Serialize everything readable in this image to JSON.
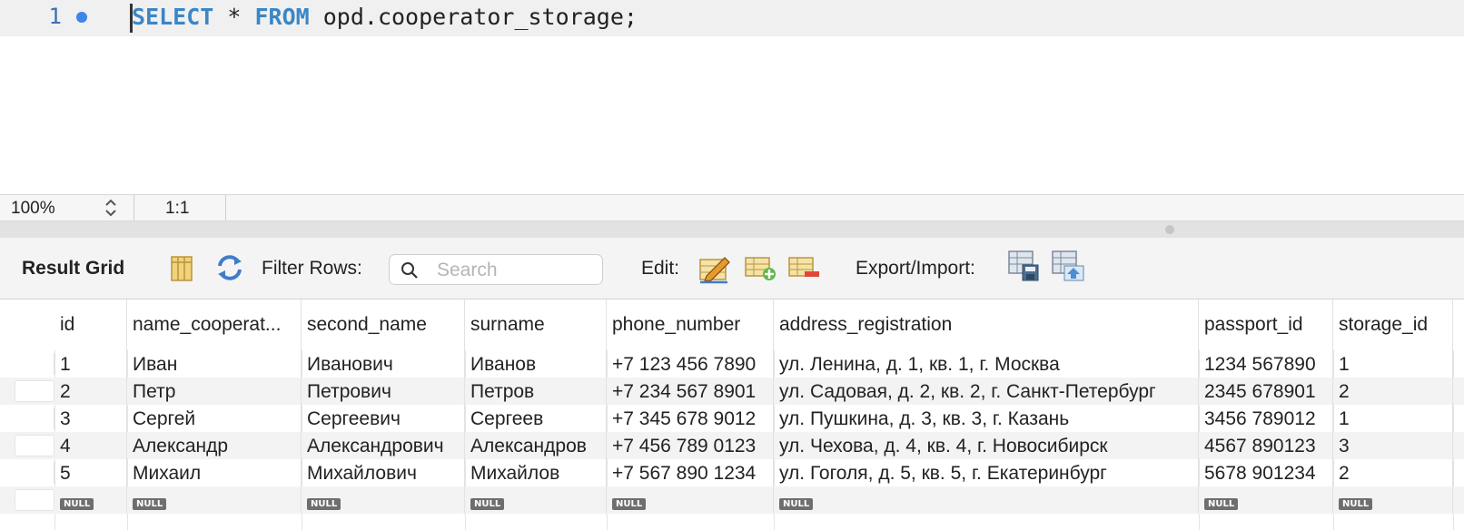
{
  "editor": {
    "line_number": "1",
    "sql_keyword_select": "SELECT",
    "sql_star": " * ",
    "sql_keyword_from": "FROM",
    "sql_rest": " opd.cooperator_storage;"
  },
  "status": {
    "zoom": "100%",
    "position": "1:1"
  },
  "toolbar": {
    "title": "Result Grid",
    "filter_label": "Filter Rows:",
    "search_placeholder": "Search",
    "search_value": "",
    "edit_label": "Edit:",
    "export_label": "Export/Import:"
  },
  "grid": {
    "columns": [
      "id",
      "name_cooperat...",
      "second_name",
      "surname",
      "phone_number",
      "address_registration",
      "passport_id",
      "storage_id"
    ],
    "rows": [
      [
        "1",
        "Иван",
        "Иванович",
        "Иванов",
        "+7 123 456 7890",
        "ул. Ленина, д. 1, кв. 1, г. Москва",
        "1234 567890",
        "1"
      ],
      [
        "2",
        "Петр",
        "Петрович",
        "Петров",
        "+7 234 567 8901",
        "ул. Садовая, д. 2, кв. 2, г. Санкт-Петербург",
        "2345 678901",
        "2"
      ],
      [
        "3",
        "Сергей",
        "Сергеевич",
        "Сергеев",
        "+7 345 678 9012",
        "ул. Пушкина, д. 3, кв. 3, г. Казань",
        "3456 789012",
        "1"
      ],
      [
        "4",
        "Александр",
        "Александрович",
        "Александров",
        "+7 456 789 0123",
        "ул. Чехова, д. 4, кв. 4, г. Новосибирск",
        "4567 890123",
        "3"
      ],
      [
        "5",
        "Михаил",
        "Михайлович",
        "Михайлов",
        "+7 567 890 1234",
        "ул. Гоголя, д. 5, кв. 5, г. Екатеринбург",
        "5678 901234",
        "2"
      ]
    ],
    "null_label": "NULL"
  },
  "icons": {
    "grid_toggle": "column-layout-icon",
    "refresh": "refresh-icon",
    "search": "search-icon",
    "edit_cell": "edit-cell-icon",
    "add_row": "add-row-icon",
    "delete_row": "delete-row-icon",
    "export": "export-icon",
    "import": "import-icon"
  },
  "colors": {
    "keyword": "#3b86c6",
    "null_badge": "#6e6e6e",
    "modified_dot": "#3b86e6"
  }
}
